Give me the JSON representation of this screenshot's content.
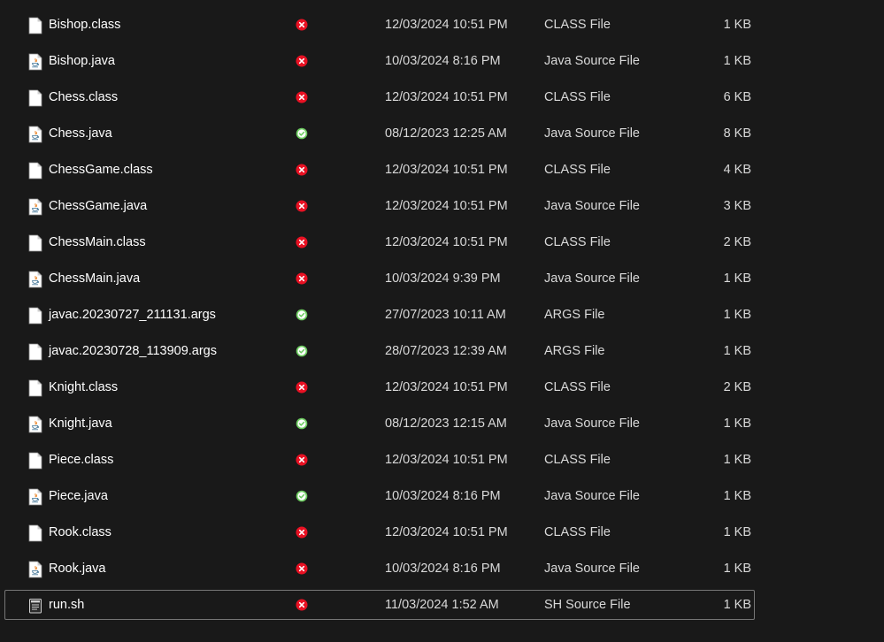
{
  "files": [
    {
      "name": "Bishop.class",
      "date": "12/03/2024 10:51 PM",
      "type": "CLASS File",
      "size": "1 KB",
      "icon": "generic-file-icon",
      "sync": "error"
    },
    {
      "name": "Bishop.java",
      "date": "10/03/2024 8:16 PM",
      "type": "Java Source File",
      "size": "1 KB",
      "icon": "java-file-icon",
      "sync": "error"
    },
    {
      "name": "Chess.class",
      "date": "12/03/2024 10:51 PM",
      "type": "CLASS File",
      "size": "6 KB",
      "icon": "generic-file-icon",
      "sync": "error"
    },
    {
      "name": "Chess.java",
      "date": "08/12/2023 12:25 AM",
      "type": "Java Source File",
      "size": "8 KB",
      "icon": "java-file-icon",
      "sync": "ok"
    },
    {
      "name": "ChessGame.class",
      "date": "12/03/2024 10:51 PM",
      "type": "CLASS File",
      "size": "4 KB",
      "icon": "generic-file-icon",
      "sync": "error"
    },
    {
      "name": "ChessGame.java",
      "date": "12/03/2024 10:51 PM",
      "type": "Java Source File",
      "size": "3 KB",
      "icon": "java-file-icon",
      "sync": "error"
    },
    {
      "name": "ChessMain.class",
      "date": "12/03/2024 10:51 PM",
      "type": "CLASS File",
      "size": "2 KB",
      "icon": "generic-file-icon",
      "sync": "error"
    },
    {
      "name": "ChessMain.java",
      "date": "10/03/2024 9:39 PM",
      "type": "Java Source File",
      "size": "1 KB",
      "icon": "java-file-icon",
      "sync": "error"
    },
    {
      "name": "javac.20230727_211131.args",
      "date": "27/07/2023 10:11 AM",
      "type": "ARGS File",
      "size": "1 KB",
      "icon": "generic-file-icon",
      "sync": "ok"
    },
    {
      "name": "javac.20230728_113909.args",
      "date": "28/07/2023 12:39 AM",
      "type": "ARGS File",
      "size": "1 KB",
      "icon": "generic-file-icon",
      "sync": "ok"
    },
    {
      "name": "Knight.class",
      "date": "12/03/2024 10:51 PM",
      "type": "CLASS File",
      "size": "2 KB",
      "icon": "generic-file-icon",
      "sync": "error"
    },
    {
      "name": "Knight.java",
      "date": "08/12/2023 12:15 AM",
      "type": "Java Source File",
      "size": "1 KB",
      "icon": "java-file-icon",
      "sync": "ok"
    },
    {
      "name": "Piece.class",
      "date": "12/03/2024 10:51 PM",
      "type": "CLASS File",
      "size": "1 KB",
      "icon": "generic-file-icon",
      "sync": "error"
    },
    {
      "name": "Piece.java",
      "date": "10/03/2024 8:16 PM",
      "type": "Java Source File",
      "size": "1 KB",
      "icon": "java-file-icon",
      "sync": "ok"
    },
    {
      "name": "Rook.class",
      "date": "12/03/2024 10:51 PM",
      "type": "CLASS File",
      "size": "1 KB",
      "icon": "generic-file-icon",
      "sync": "error"
    },
    {
      "name": "Rook.java",
      "date": "10/03/2024 8:16 PM",
      "type": "Java Source File",
      "size": "1 KB",
      "icon": "java-file-icon",
      "sync": "error"
    },
    {
      "name": "run.sh",
      "date": "11/03/2024 1:52 AM",
      "type": "SH Source File",
      "size": "1 KB",
      "icon": "script-file-icon",
      "sync": "error",
      "focused": true
    }
  ],
  "colors": {
    "background": "#191919",
    "sync_error": "#e81123",
    "sync_ok": "#6ccb5f",
    "focus_border": "#767676"
  }
}
